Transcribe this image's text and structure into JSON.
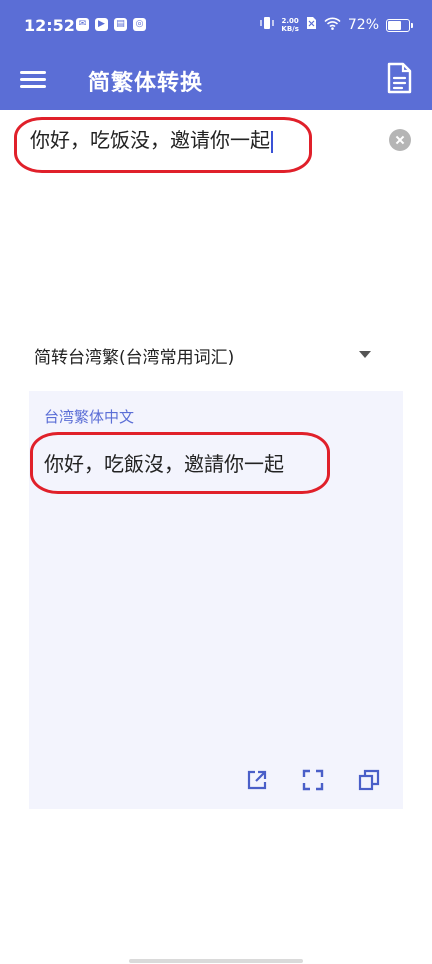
{
  "status_bar": {
    "time": "12:52",
    "net_speed_value": "2.00",
    "net_speed_unit": "KB/s",
    "battery_text": "72%",
    "battery_level": 0.72
  },
  "app_bar": {
    "title": "简繁体转换",
    "menu_icon": "hamburger-menu-icon",
    "doc_icon": "document-icon"
  },
  "input": {
    "text": "你好，吃饭没，邀请你一起",
    "clear_icon": "clear-icon"
  },
  "conversion": {
    "selected_mode": "简转台湾繁(台湾常用词汇)"
  },
  "output": {
    "caption": "台湾繁体中文",
    "text": "你好，吃飯沒，邀請你一起",
    "tools": [
      "open-external-icon",
      "fullscreen-icon",
      "copy-icon"
    ]
  },
  "colors": {
    "accent": "#5b6ed6",
    "output_bg": "#f3f4fd",
    "highlight_circle": "#e0202a"
  }
}
